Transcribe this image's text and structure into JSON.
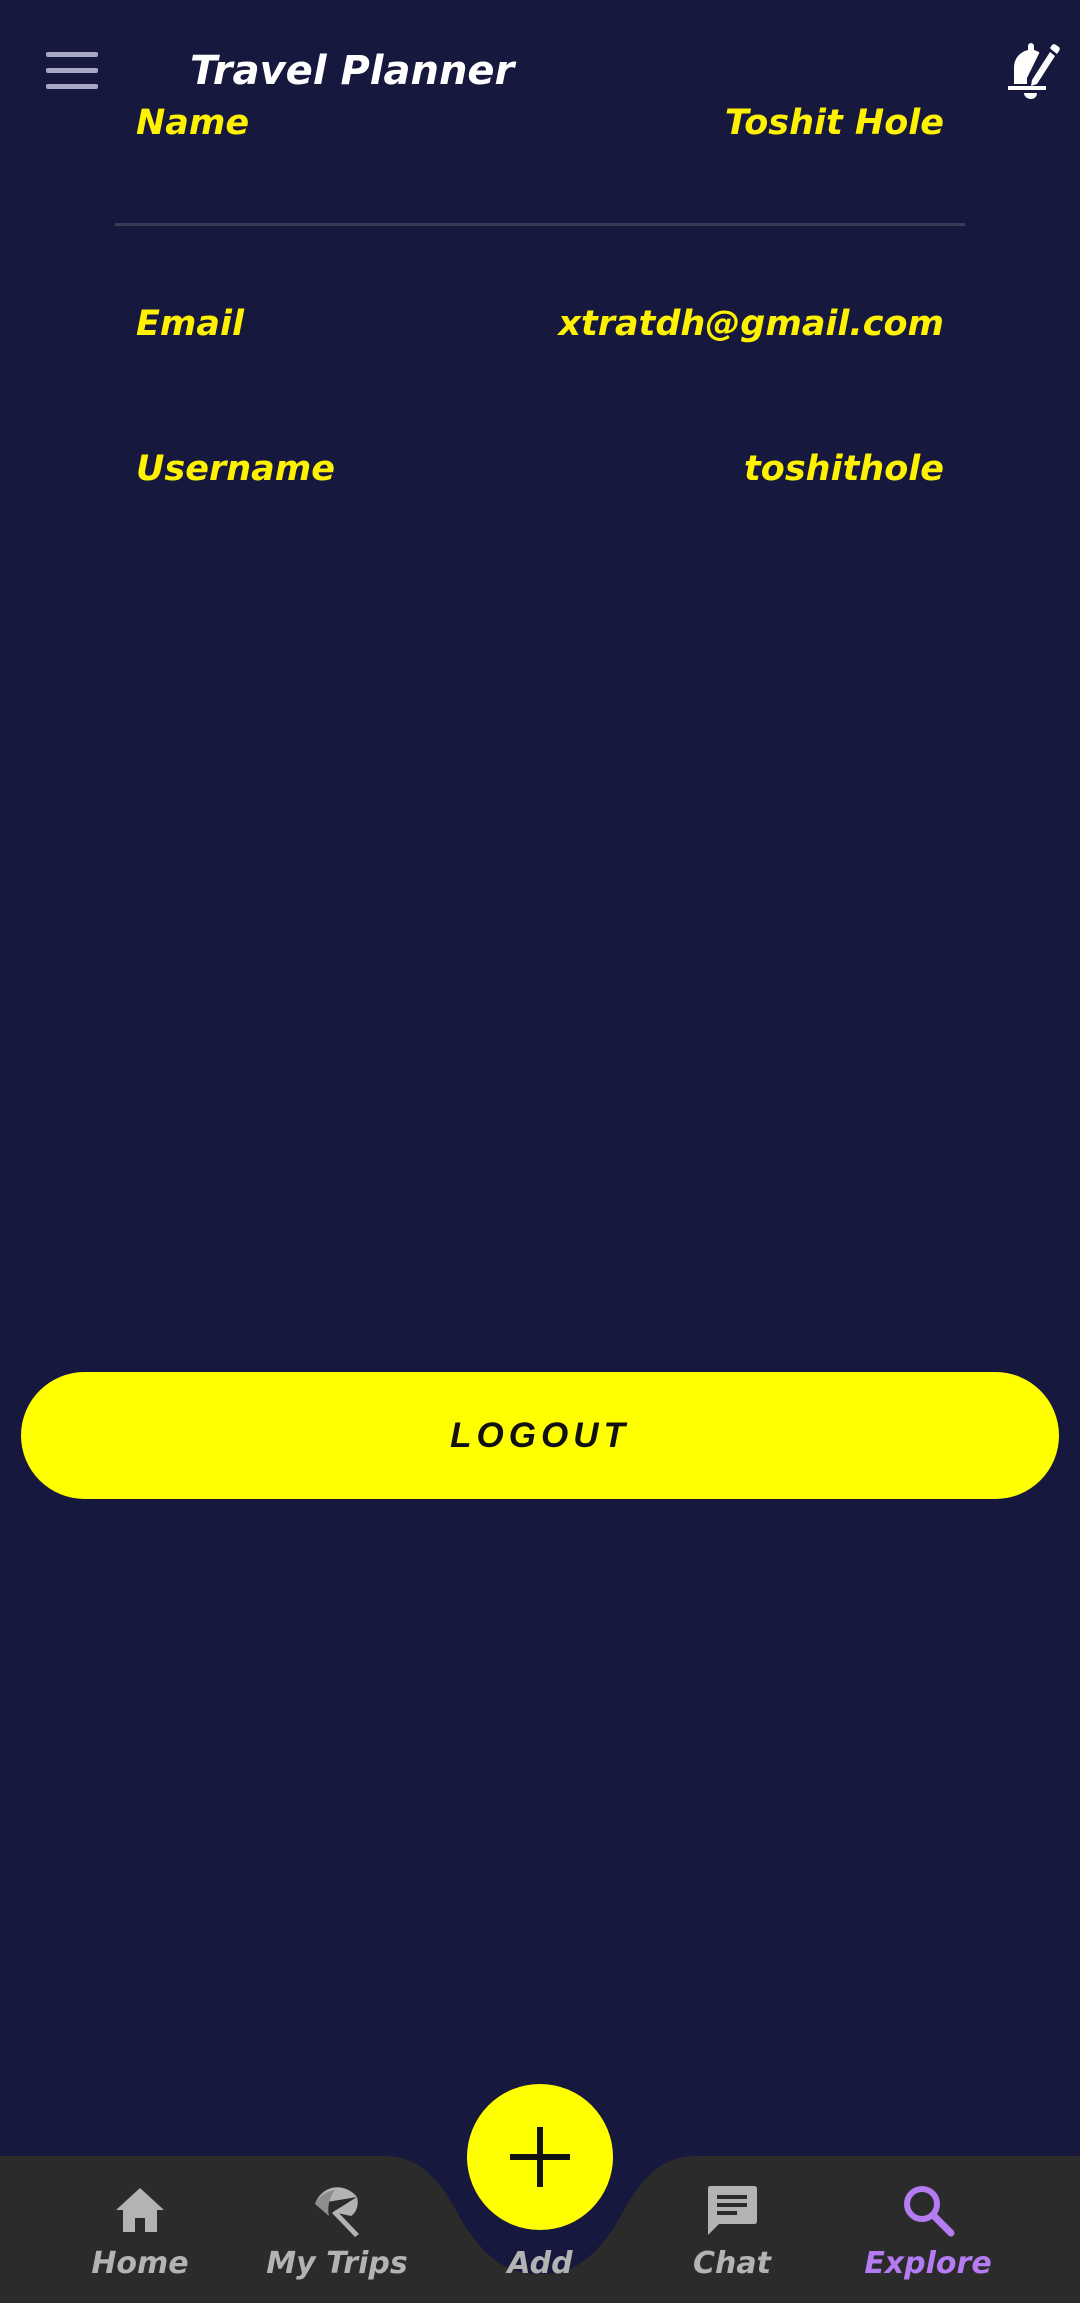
{
  "header": {
    "title": "Travel Planner",
    "menu_icon": "hamburger-menu-icon",
    "notification_icon": "bell-edit-icon"
  },
  "profile": {
    "name_label": "Name",
    "name_value": "Toshit Hole",
    "email_label": "Email",
    "email_value": "xtratdh@gmail.com",
    "username_label": "Username",
    "username_value": "toshithole"
  },
  "logout": {
    "label": "LOGOUT"
  },
  "bottom_nav": {
    "items": [
      {
        "label": "Home",
        "icon": "home-icon"
      },
      {
        "label": "My Trips",
        "icon": "beach-umbrella-icon"
      },
      {
        "label": "Add",
        "icon": "plus-icon"
      },
      {
        "label": "Chat",
        "icon": "chat-icon"
      },
      {
        "label": "Explore",
        "icon": "search-icon",
        "active": true
      }
    ]
  },
  "colors": {
    "background": "#17183d",
    "accent": "#ffff00",
    "nav_background": "#2b2b2b",
    "nav_inactive": "#b3b3b3",
    "nav_active": "#b57bf2",
    "text_primary": "#ffffff"
  }
}
